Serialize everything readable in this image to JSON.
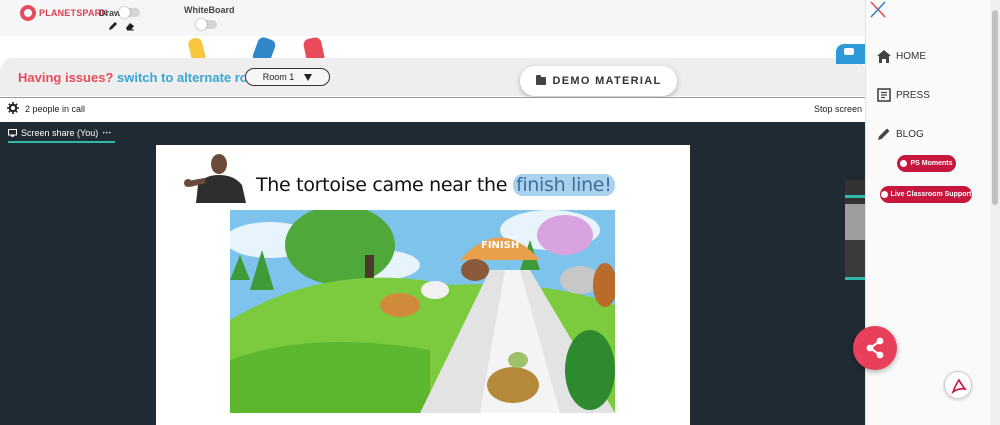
{
  "brand": {
    "name": "PLANETSPARK"
  },
  "toolbar": {
    "draw_label": "Draw",
    "whiteboard_label": "WhiteBoard",
    "pencil_icon": "pencil-icon",
    "eraser_icon": "eraser-icon"
  },
  "issues": {
    "prefix": "Having issues?",
    "link": "switch to alternate room",
    "room_value": "Room 1"
  },
  "demo_material_label": "DEMO MATERIAL",
  "call": {
    "people_text": "2 people in call",
    "stop_text": "Stop screen"
  },
  "screen_share": {
    "tab_label": "Screen share (You)",
    "menu_glyph": "⋯"
  },
  "slide": {
    "text_prefix": "The tortoise came near the",
    "text_highlight": "finish line!",
    "sign_text": "FINISH"
  },
  "sidepanel": {
    "nav": [
      {
        "label": "HOME",
        "icon": "home-icon"
      },
      {
        "label": "PRESS",
        "icon": "news-icon"
      },
      {
        "label": "BLOG",
        "icon": "pencil-icon"
      }
    ],
    "pills": [
      {
        "label": "PS Moments"
      },
      {
        "label": "Live Classroom Support"
      }
    ]
  },
  "colors": {
    "brand_red": "#e94b5a",
    "link_blue": "#3aa6d4",
    "stage_dark": "#1f2a33",
    "accent_teal": "#2fb8a9",
    "pill_red": "#c8173f",
    "fab_red": "#e8405b",
    "highlight_blue": "#a8d2ee"
  }
}
